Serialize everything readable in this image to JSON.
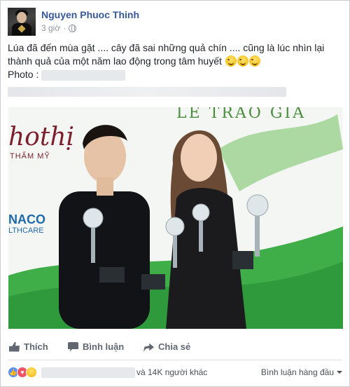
{
  "post": {
    "author": "Nguyen Phuoc Thinh",
    "time": "3 giờ",
    "privacy_icon": "globe-icon",
    "text_line1": "Lúa đã đến mùa gặt .... cây đã sai những quả chín .... cũng là lúc nhìn lại",
    "text_line2": "thành quả của một năm lao động trong tâm huyết",
    "photo_label": "Photo :"
  },
  "photo": {
    "banner": "LỄ TRAO GIẢ",
    "brand_name": "hothị",
    "brand_sub": "THẨM MỸ",
    "sponsor": "NACO",
    "sponsor_sub": "LTHCARE",
    "swirl_text": "h"
  },
  "actions": {
    "like": "Thích",
    "comment": "Bình luận",
    "share": "Chia sẻ"
  },
  "reactions": {
    "others": "và 14K người khác",
    "sort_label": "Bình luận hàng đầu"
  },
  "colors": {
    "link": "#365899",
    "like": "#5890ff",
    "love": "#f25268",
    "brand_green": "#3fa53a"
  }
}
